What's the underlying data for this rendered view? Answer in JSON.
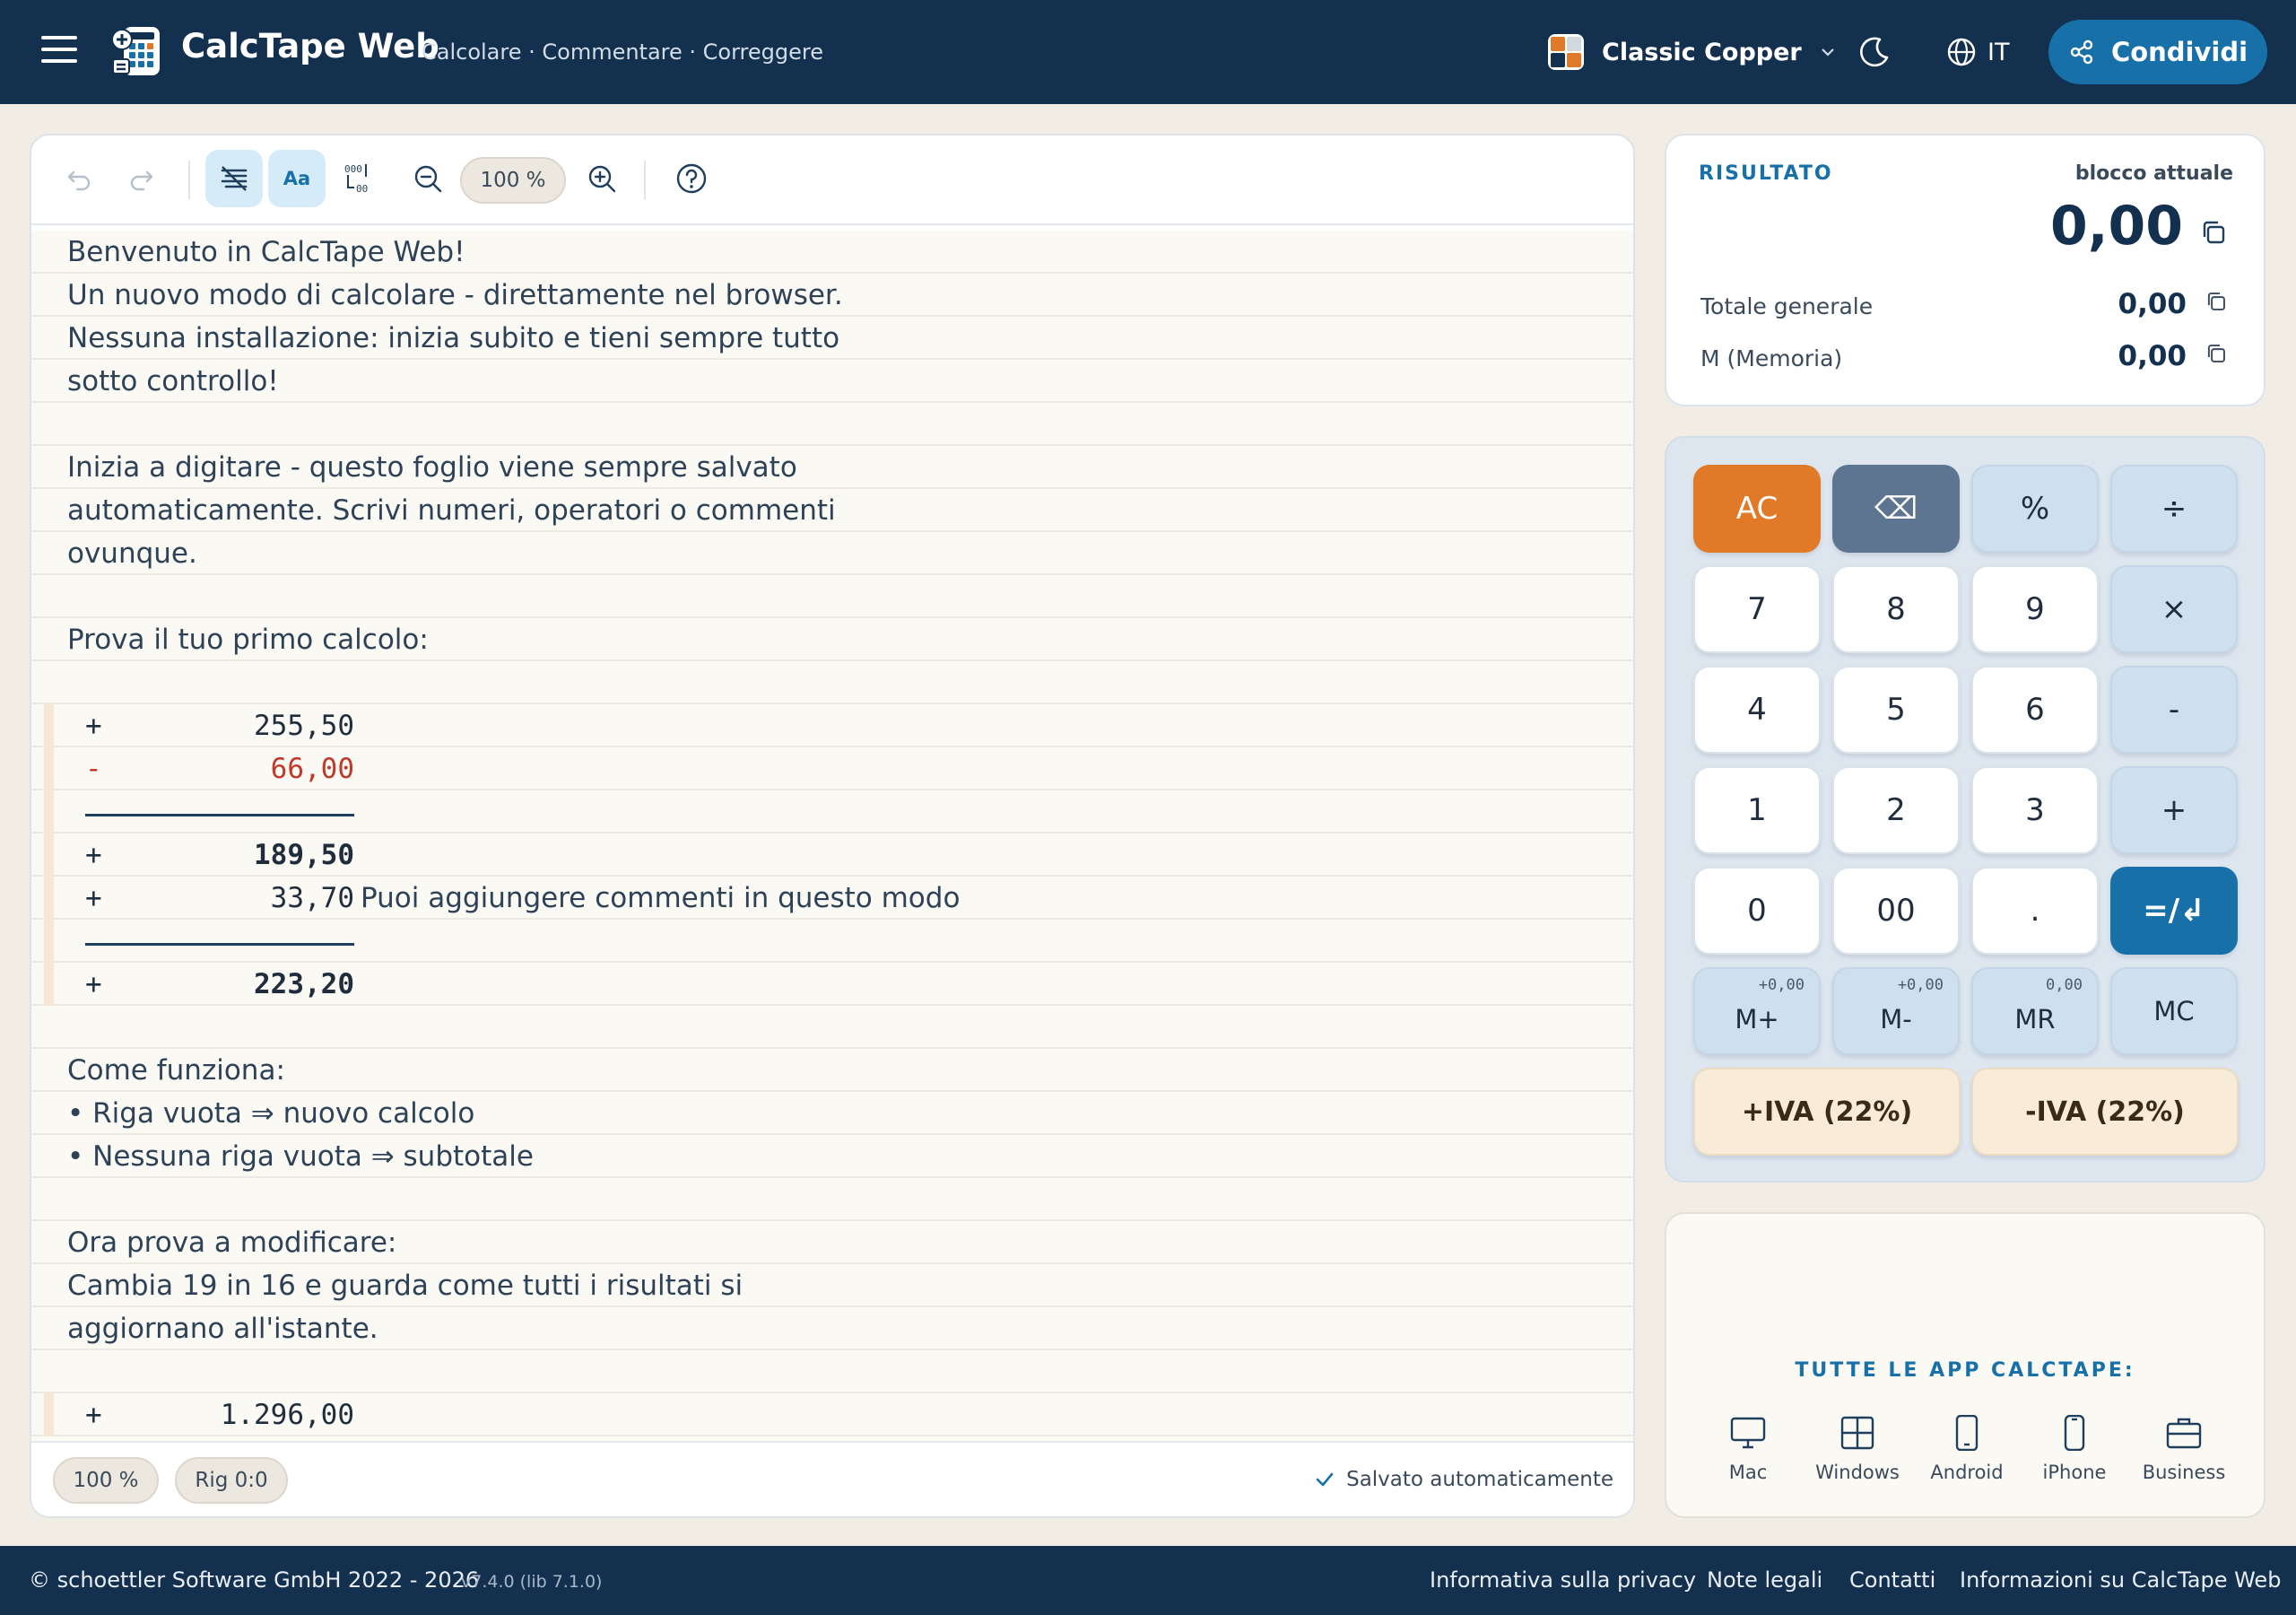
{
  "header": {
    "app_title": "CalcTape Web",
    "tagline": "Calcolare · Commentare · Correggere",
    "theme_name": "Classic Copper",
    "language": "IT",
    "share_label": "Condividi",
    "icons": [
      "menu-icon",
      "app-logo",
      "palette-icon",
      "chevron-down-icon",
      "moon-icon",
      "globe-icon",
      "share-icon"
    ]
  },
  "toolbar": {
    "zoom": "100 %",
    "aa_label": "Aa",
    "icons": [
      "undo-icon",
      "redo-icon",
      "format-lines-icon",
      "font-size-icon",
      "number-format-icon",
      "zoom-out-icon",
      "zoom-in-icon",
      "help-icon"
    ]
  },
  "tape": {
    "lines": [
      {
        "text": "Benvenuto in CalcTape Web!"
      },
      {
        "text": "Un nuovo modo di calcolare - direttamente nel browser."
      },
      {
        "text": "Nessuna installazione: inizia subito e tieni sempre tutto"
      },
      {
        "text": "sotto controllo!"
      },
      {
        "text": ""
      },
      {
        "text": "Inizia a digitare - questo foglio viene sempre salvato"
      },
      {
        "text": "automaticamente. Scrivi numeri, operatori o commenti"
      },
      {
        "text": "ovunque."
      },
      {
        "text": ""
      },
      {
        "text": "Prova il tuo primo calcolo:"
      },
      {
        "text": ""
      },
      {
        "op": "+",
        "value": "255,50"
      },
      {
        "op": "-",
        "value": "66,00"
      },
      {
        "rule": true
      },
      {
        "op": "+",
        "value": "189,50",
        "bold": true
      },
      {
        "op": "+",
        "value": "33,70",
        "comment": "Puoi aggiungere commenti in questo modo"
      },
      {
        "rule": true
      },
      {
        "op": "+",
        "value": "223,20",
        "bold": true
      },
      {
        "text": ""
      },
      {
        "text": "Come funziona:"
      },
      {
        "text": "• Riga vuota ⇒ nuovo calcolo"
      },
      {
        "text": "• Nessuna riga vuota ⇒ subtotale"
      },
      {
        "text": ""
      },
      {
        "text": "Ora prova a modificare:"
      },
      {
        "text": "Cambia 19 in 16 e guarda come tutti i risultati si"
      },
      {
        "text": "aggiornano all'istante."
      },
      {
        "text": ""
      },
      {
        "op": "+",
        "value": "1.296,00"
      }
    ]
  },
  "status": {
    "zoom": "100 %",
    "position": "Rig 0:0",
    "saved": "Salvato automaticamente"
  },
  "result": {
    "label": "RISULTATO",
    "sublabel": "blocco attuale",
    "value": "0,00",
    "grand_total_label": "Totale generale",
    "grand_total_value": "0,00",
    "memory_label": "M (Memoria)",
    "memory_value": "0,00"
  },
  "keypad": {
    "keys": [
      [
        "AC",
        "⌫",
        "%",
        "÷"
      ],
      [
        "7",
        "8",
        "9",
        "×"
      ],
      [
        "4",
        "5",
        "6",
        "-"
      ],
      [
        "1",
        "2",
        "3",
        "+"
      ],
      [
        "0",
        "00",
        ".",
        "=/↲"
      ]
    ],
    "memory": [
      {
        "label": "M+",
        "hint": "+0,00"
      },
      {
        "label": "M-",
        "hint": "+0,00"
      },
      {
        "label": "MR",
        "hint": "0,00"
      },
      {
        "label": "MC",
        "hint": ""
      }
    ],
    "vat_add": "+IVA (22%)",
    "vat_sub": "-IVA (22%)"
  },
  "apps": {
    "title": "TUTTE LE APP CALCTAPE:",
    "items": [
      {
        "label": "Mac",
        "icon": "monitor-icon"
      },
      {
        "label": "Windows",
        "icon": "windows-icon"
      },
      {
        "label": "Android",
        "icon": "android-phone-icon"
      },
      {
        "label": "iPhone",
        "icon": "iphone-icon"
      },
      {
        "label": "Business",
        "icon": "briefcase-icon"
      }
    ]
  },
  "footer": {
    "copyright": "© schoettler Software GmbH 2022 - 2026",
    "version": "v7.4.0 (lib 7.1.0)",
    "links": [
      "Informativa sulla privacy",
      "Note legali",
      "Contatti",
      "Informazioni su CalcTape Web"
    ]
  },
  "colors": {
    "header_bg": "#13304f",
    "accent": "#1870a8",
    "ac_key": "#e07a28",
    "negative": "#c0392b",
    "paper": "#fbf9f4"
  }
}
